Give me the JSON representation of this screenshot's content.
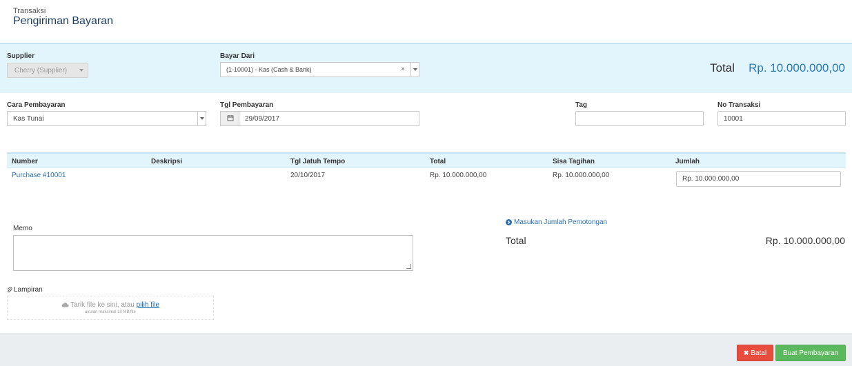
{
  "header": {
    "breadcrumb": "Transaksi",
    "title": "Pengiriman Bayaran"
  },
  "supplier": {
    "label": "Supplier",
    "value": "Cherry (Supplier)"
  },
  "bayar_dari": {
    "label": "Bayar Dari",
    "value": "(1-10001) - Kas (Cash & Bank)"
  },
  "total": {
    "label": "Total",
    "value": "Rp. 10.000.000,00"
  },
  "cara_pembayaran": {
    "label": "Cara Pembayaran",
    "value": "Kas Tunai"
  },
  "tgl_pembayaran": {
    "label": "Tgl Pembayaran",
    "value": "29/09/2017"
  },
  "tag": {
    "label": "Tag",
    "value": ""
  },
  "no_transaksi": {
    "label": "No Transaksi",
    "value": "10001"
  },
  "table": {
    "columns": [
      "Number",
      "Deskripsi",
      "Tgl Jatuh Tempo",
      "Total",
      "Sisa Tagihan",
      "Jumlah"
    ],
    "rows": [
      {
        "number": "Purchase #10001",
        "deskripsi": "",
        "due": "20/10/2017",
        "total": "Rp. 10.000.000,00",
        "sisa": "Rp. 10.000.000,00",
        "jumlah": "Rp. 10.000.000,00"
      }
    ]
  },
  "potongan_link": "Masukan Jumlah Pemotongan",
  "summary": {
    "label": "Total",
    "value": "Rp. 10.000.000,00"
  },
  "memo": {
    "label": "Memo",
    "value": ""
  },
  "lampiran": {
    "label": "Lampiran",
    "drop_text": "Tarik file ke sini, atau ",
    "drop_link": "pilih file",
    "size_note": "ukuran maksimal 10 MB/file"
  },
  "buttons": {
    "cancel": "Batal",
    "submit": "Buat Pembayaran"
  },
  "colors": {
    "accent": "#2a7bb4",
    "band": "#e2f4fc",
    "danger": "#e74c3c",
    "success": "#5cb85c"
  }
}
